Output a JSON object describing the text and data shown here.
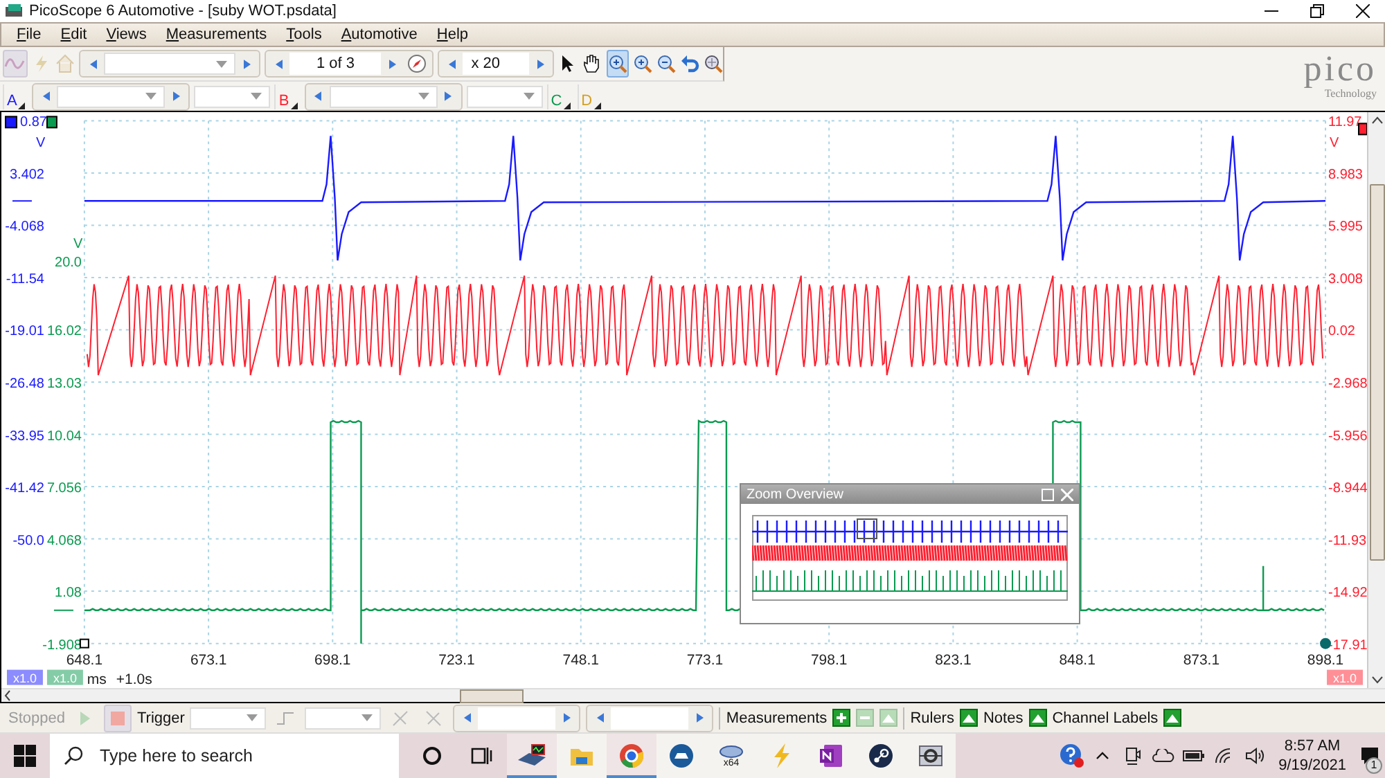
{
  "window": {
    "title": "PicoScope 6 Automotive - [suby WOT.psdata]"
  },
  "menu": [
    "File",
    "Edit",
    "Views",
    "Measurements",
    "Tools",
    "Automotive",
    "Help"
  ],
  "toolbar": {
    "page": "1 of 3",
    "zoom": "x 20",
    "tools": [
      {
        "kind": "pointer",
        "selected": false
      },
      {
        "kind": "hand",
        "selected": false
      },
      {
        "kind": "zoom-box",
        "selected": true
      },
      {
        "kind": "zoom-in",
        "selected": false
      },
      {
        "kind": "zoom-out",
        "selected": false
      },
      {
        "kind": "undo",
        "selected": false
      },
      {
        "kind": "zoom-overview",
        "selected": false
      }
    ]
  },
  "logo": {
    "name": "pico",
    "tagline": "Technology"
  },
  "channels": [
    {
      "letter": "A",
      "color": "#1a1aff"
    },
    {
      "letter": "B",
      "color": "#ff2030"
    },
    {
      "letter": "C",
      "color": "#0a9a50"
    },
    {
      "letter": "D",
      "color": "#d4a020"
    }
  ],
  "axes": [
    {
      "unit": "V",
      "ticks": [
        "0.87",
        "3.402",
        "-4.068",
        "-11.54",
        "-19.01",
        "-26.48",
        "-33.95",
        "-41.42",
        "-50.0"
      ]
    },
    {
      "unit": "V",
      "ticks": [
        "20.0",
        "16.02",
        "13.03",
        "10.04",
        "7.056",
        "4.068",
        "1.08",
        "-1.908"
      ]
    },
    {
      "unit": "V",
      "ticks": [
        "11.97",
        "8.983",
        "5.995",
        "3.008",
        "0.02",
        "-2.968",
        "-5.956",
        "-8.944",
        "-11.93",
        "-14.92",
        "-17.91"
      ]
    }
  ],
  "x_axis": {
    "ticks": [
      "648.1",
      "673.1",
      "698.1",
      "723.1",
      "748.1",
      "773.1",
      "798.1",
      "823.1",
      "848.1",
      "873.1",
      "898.1"
    ],
    "unit": "ms",
    "offset": "+1.0s"
  },
  "scale_badges": [
    {
      "text": "x1.0"
    },
    {
      "text": "x1.0"
    },
    {
      "text": "x1.0"
    }
  ],
  "zoom_overview": {
    "title": "Zoom Overview"
  },
  "status_bar": {
    "state": "Stopped",
    "trigger": "Trigger",
    "sections": [
      {
        "label": "Measurements",
        "kind": "measurements"
      },
      {
        "label": "Rulers",
        "kind": "toggle"
      },
      {
        "label": "Notes",
        "kind": "toggle"
      },
      {
        "label": "Channel Labels",
        "kind": "toggle"
      }
    ]
  },
  "taskbar": {
    "search_placeholder": "Type here to search",
    "apps": [
      {
        "kind": "picoscope",
        "running": true
      },
      {
        "kind": "folder",
        "running": false
      },
      {
        "kind": "chrome",
        "running": true
      },
      {
        "kind": "bluecar",
        "running": false
      },
      {
        "kind": "pico64",
        "running": false,
        "label": "x64"
      },
      {
        "kind": "lightning",
        "running": false
      },
      {
        "kind": "onenote",
        "running": false
      },
      {
        "kind": "steam",
        "running": false
      },
      {
        "kind": "gearapp",
        "running": false
      }
    ],
    "time": "8:57 AM",
    "date": "9/19/2021",
    "notifications": "1"
  }
}
